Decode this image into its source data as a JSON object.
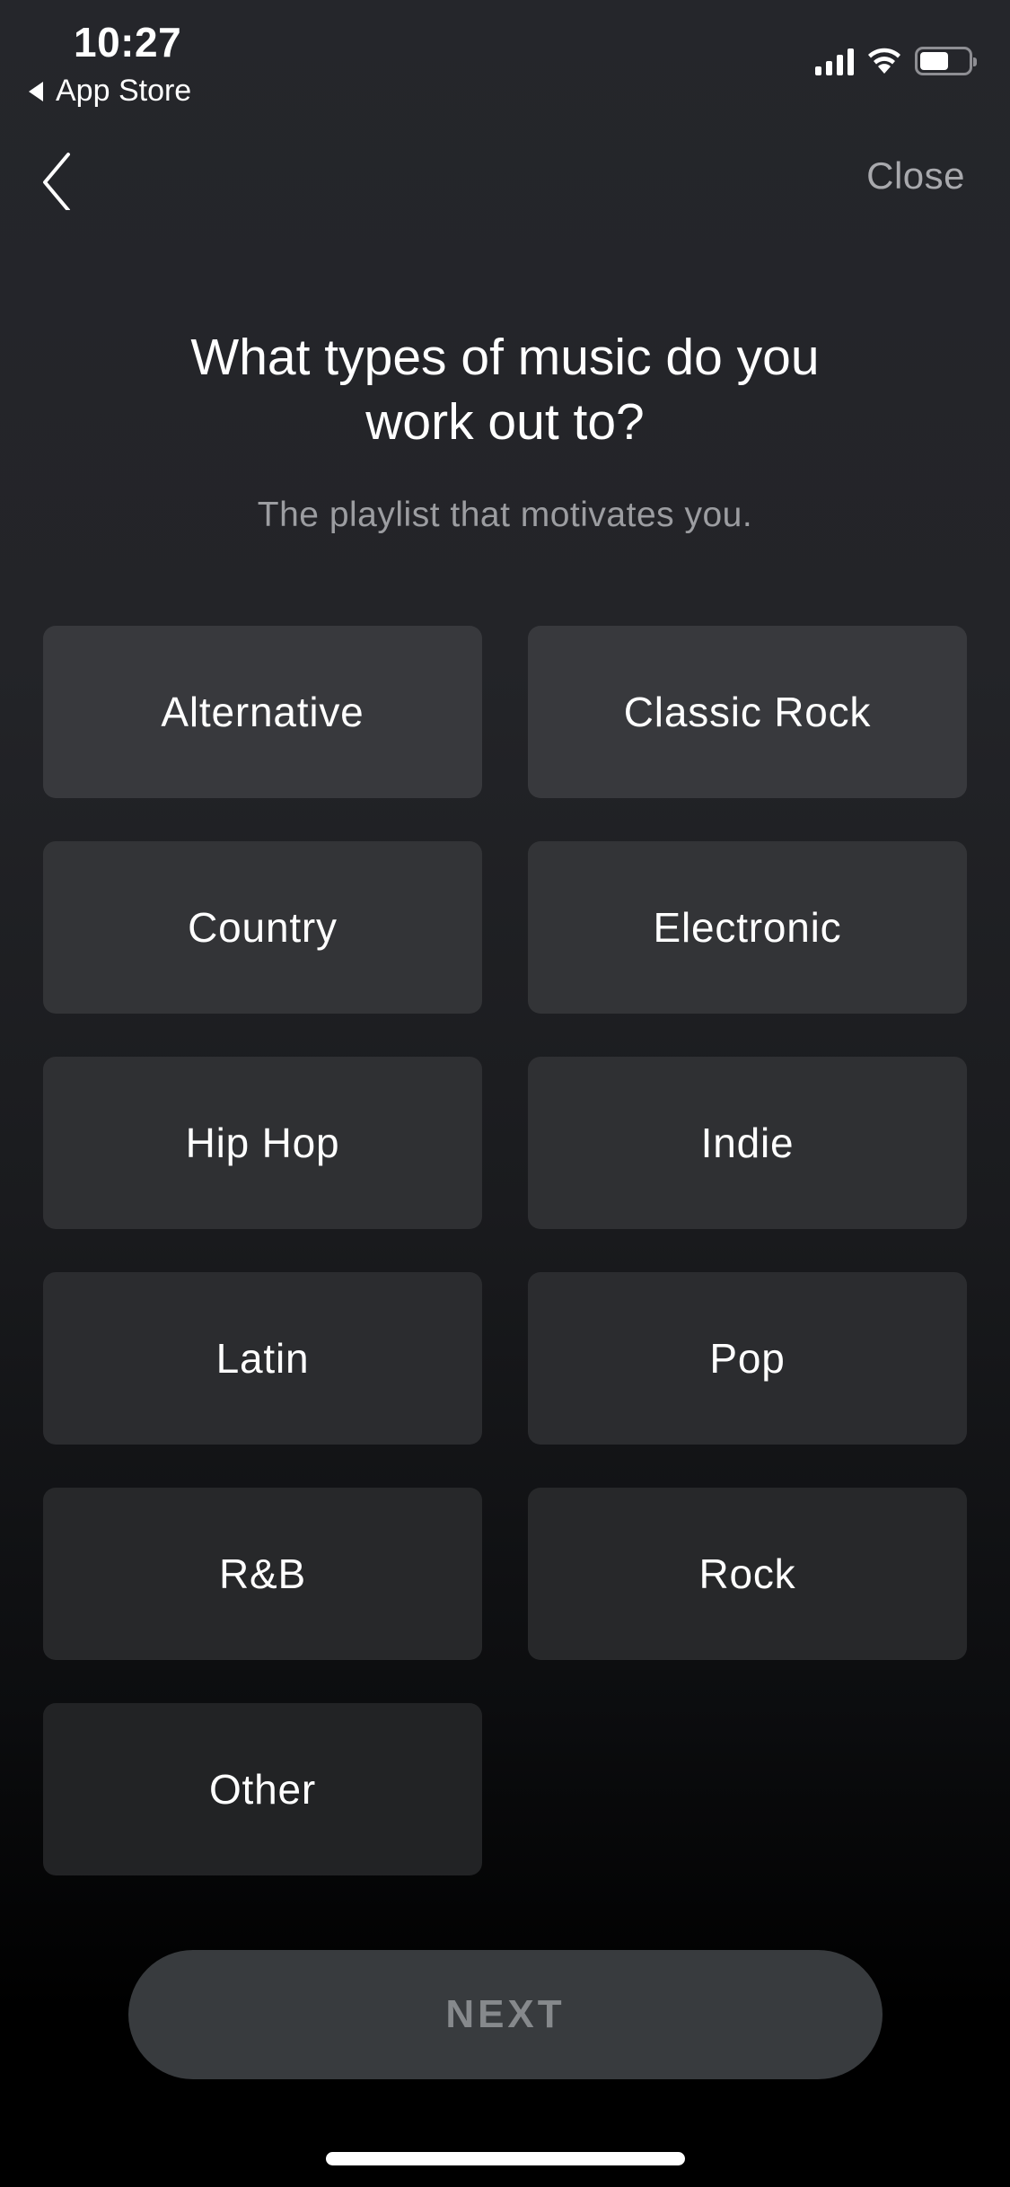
{
  "status_bar": {
    "time": "10:27",
    "back_app_label": "App Store",
    "icons": [
      "cellular-signal-icon",
      "wifi-icon",
      "battery-icon"
    ],
    "battery_level": 0.6
  },
  "nav": {
    "back_icon": "chevron-left-icon",
    "close_label": "Close"
  },
  "header": {
    "title": "What types of music do you work out to?",
    "subtitle": "The playlist that motivates you."
  },
  "genres": [
    {
      "label": "Alternative"
    },
    {
      "label": "Classic Rock"
    },
    {
      "label": "Country"
    },
    {
      "label": "Electronic"
    },
    {
      "label": "Hip Hop"
    },
    {
      "label": "Indie"
    },
    {
      "label": "Latin"
    },
    {
      "label": "Pop"
    },
    {
      "label": "R&B"
    },
    {
      "label": "Rock"
    },
    {
      "label": "Other"
    }
  ],
  "footer": {
    "next_label": "NEXT"
  },
  "colors": {
    "background_top": "#25262b",
    "background_bottom": "#000000",
    "tile": "#37383c",
    "next_button": "#383b3e",
    "next_text_disabled": "#86898c",
    "secondary_text": "#9c9da1"
  }
}
